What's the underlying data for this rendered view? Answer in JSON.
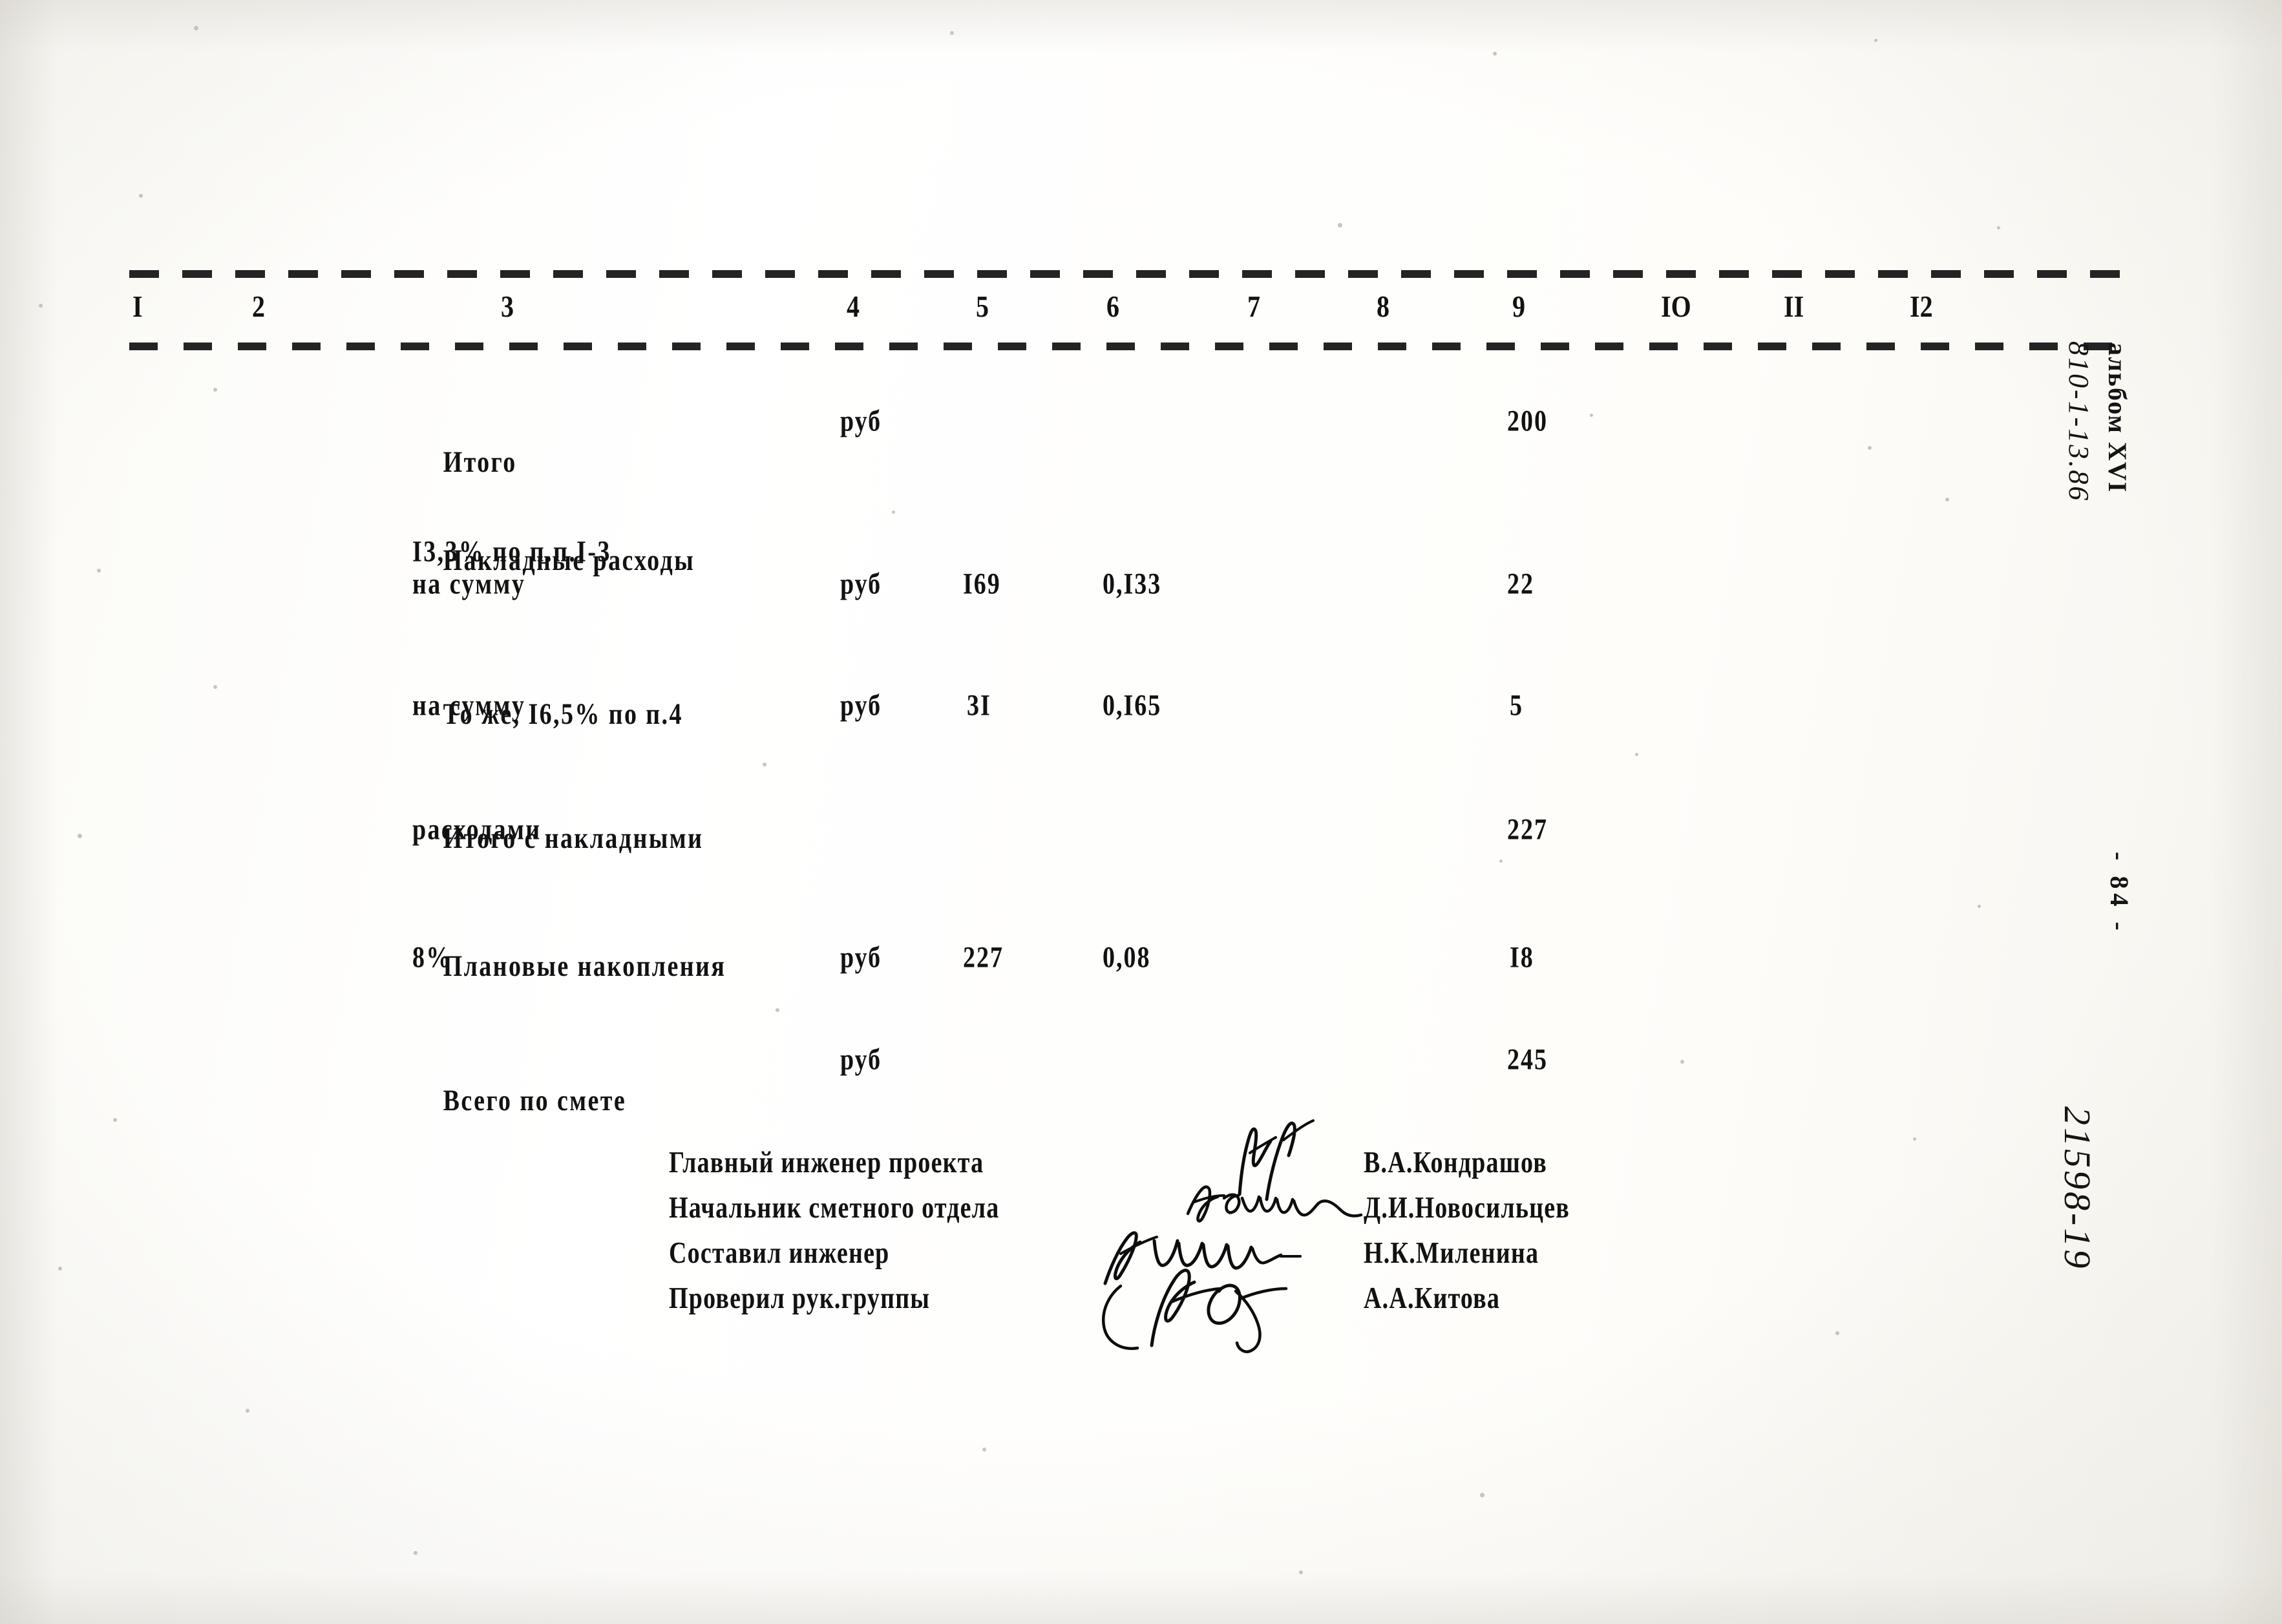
{
  "document": {
    "type": "soviet-construction-cost-estimate-sheet",
    "page_number_margin": "- 84 -",
    "album_label": "альбом XVI",
    "album_code_handwritten": "810-1-13.86",
    "drawing_code_handwritten": "21598-19"
  },
  "table": {
    "column_headers": [
      "I",
      "2",
      "3",
      "4",
      "5",
      "6",
      "7",
      "8",
      "9",
      "IO",
      "II",
      "I2"
    ],
    "rows": [
      {
        "id": "itogo",
        "description_lines": [
          "Итого"
        ],
        "unit": "руб",
        "col5": "",
        "col6": "",
        "col9": "200"
      },
      {
        "id": "nakladnye-raskhody",
        "description_lines": [
          "Накладные расходы",
          "I3,3% по п.п.I-3",
          "на сумму"
        ],
        "unit": "руб",
        "col5": "I69",
        "col6": "0,I33",
        "col9": "22"
      },
      {
        "id": "to-zhe",
        "description_lines": [
          "То же, I6,5% по п.4",
          "на сумму"
        ],
        "unit": "руб",
        "col5": "3I",
        "col6": "0,I65",
        "col9": "5"
      },
      {
        "id": "itogo-s-nakladnymi",
        "description_lines": [
          "Итого с накладными",
          "расходами"
        ],
        "unit": "",
        "col5": "",
        "col6": "",
        "col9": "227"
      },
      {
        "id": "planovye-nakopleniya",
        "description_lines": [
          "Плановые накопления",
          "8%"
        ],
        "unit": "руб",
        "col5": "227",
        "col6": "0,08",
        "col9": "I8"
      },
      {
        "id": "vsego-po-smete",
        "description_lines": [
          "Всего по смете"
        ],
        "unit": "руб",
        "col5": "",
        "col6": "",
        "col9": "245"
      }
    ]
  },
  "signatures": [
    {
      "role": "Главный инженер проекта",
      "name": "В.А.Кондрашов"
    },
    {
      "role": "Начальник сметного отдела",
      "name": "Д.И.Новосильцев"
    },
    {
      "role": "Составил инженер",
      "name": "Н.К.Миленина"
    },
    {
      "role": "Проверил рук.группы",
      "name": "А.А.Китова"
    }
  ]
}
